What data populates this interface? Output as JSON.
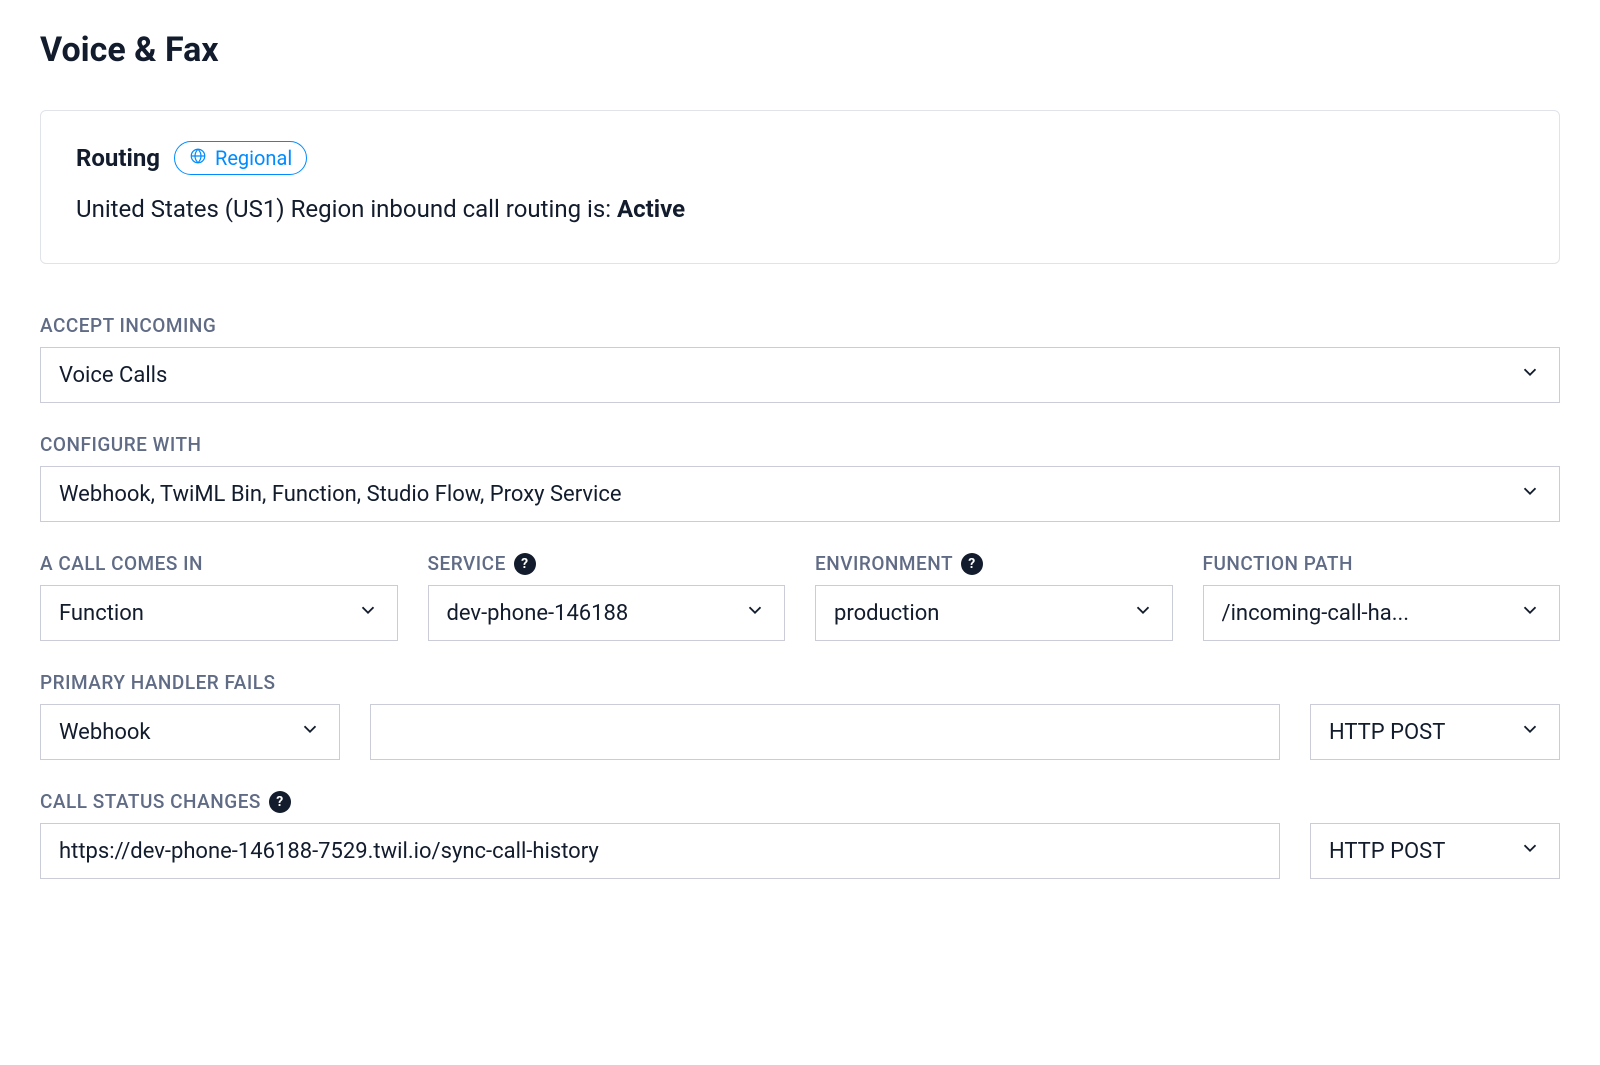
{
  "page": {
    "title": "Voice & Fax"
  },
  "routing": {
    "heading": "Routing",
    "pill_label": "Regional",
    "status_prefix": "United States (US1) Region inbound call routing is: ",
    "status_value": "Active"
  },
  "fields": {
    "accept_incoming": {
      "label": "ACCEPT INCOMING",
      "value": "Voice Calls"
    },
    "configure_with": {
      "label": "CONFIGURE WITH",
      "value": "Webhook, TwiML Bin, Function, Studio Flow, Proxy Service"
    },
    "call_comes_in": {
      "label": "A CALL COMES IN",
      "value": "Function"
    },
    "service": {
      "label": "SERVICE",
      "value": "dev-phone-146188"
    },
    "environment": {
      "label": "ENVIRONMENT",
      "value": "production"
    },
    "function_path": {
      "label": "FUNCTION PATH",
      "value": "/incoming-call-ha..."
    },
    "primary_handler_fails": {
      "label": "PRIMARY HANDLER FAILS",
      "handler_value": "Webhook",
      "url_value": "",
      "method_value": "HTTP POST"
    },
    "call_status_changes": {
      "label": "CALL STATUS CHANGES",
      "url_value": "https://dev-phone-146188-7529.twil.io/sync-call-history",
      "method_value": "HTTP POST"
    }
  }
}
